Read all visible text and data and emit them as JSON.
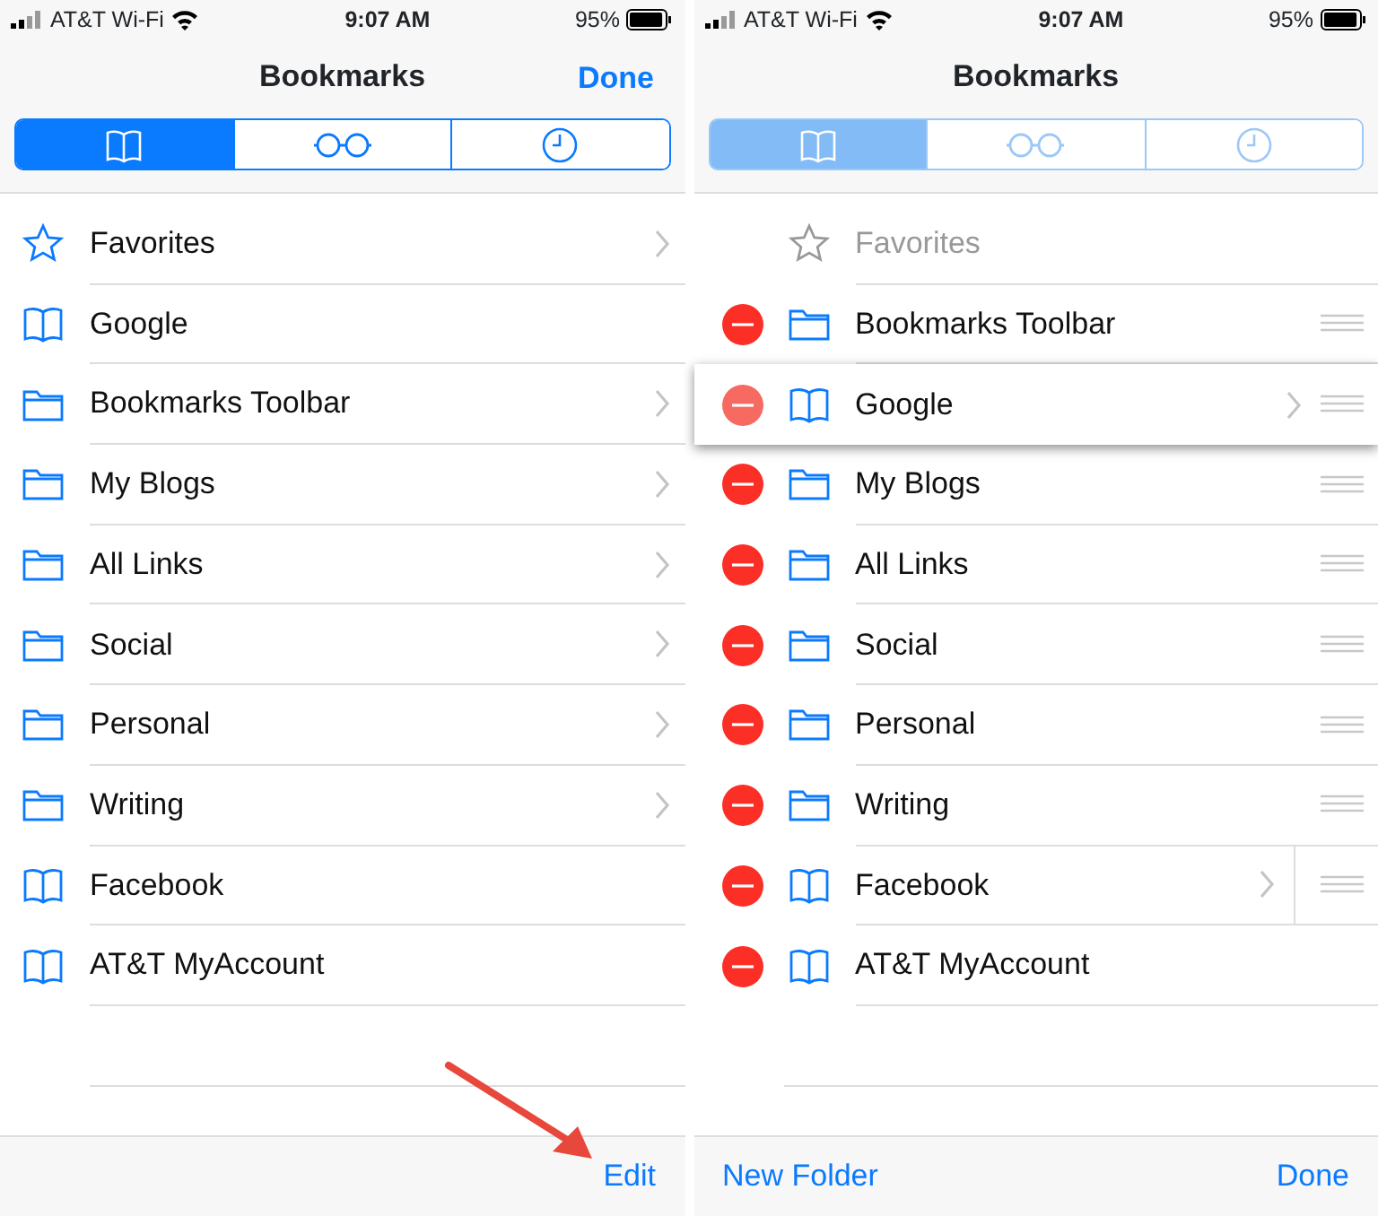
{
  "screens": [
    {
      "status": {
        "carrier": "AT&T Wi-Fi",
        "time": "9:07 AM",
        "battery": "95%"
      },
      "title": "Bookmarks",
      "nav_button": "Done",
      "editing": false,
      "segments": [
        {
          "kind": "bookmarks",
          "selected": true
        },
        {
          "kind": "reading-list",
          "selected": false
        },
        {
          "kind": "history",
          "selected": false
        }
      ],
      "items": [
        {
          "kind": "star",
          "label": "Favorites",
          "chevron": true
        },
        {
          "kind": "book",
          "label": "Google",
          "chevron": false
        },
        {
          "kind": "folder",
          "label": "Bookmarks Toolbar",
          "chevron": true
        },
        {
          "kind": "folder",
          "label": "My Blogs",
          "chevron": true
        },
        {
          "kind": "folder",
          "label": "All Links",
          "chevron": true
        },
        {
          "kind": "folder",
          "label": "Social",
          "chevron": true
        },
        {
          "kind": "folder",
          "label": "Personal",
          "chevron": true
        },
        {
          "kind": "folder",
          "label": "Writing",
          "chevron": true
        },
        {
          "kind": "book",
          "label": "Facebook",
          "chevron": false
        },
        {
          "kind": "book",
          "label": "AT&T MyAccount",
          "chevron": false
        }
      ],
      "toolbar": {
        "right": "Edit"
      },
      "annotation": {
        "kind": "arrow"
      }
    },
    {
      "status": {
        "carrier": "AT&T Wi-Fi",
        "time": "9:07 AM",
        "battery": "95%"
      },
      "title": "Bookmarks",
      "editing": true,
      "segments": [
        {
          "kind": "bookmarks",
          "selected": true
        },
        {
          "kind": "reading-list",
          "selected": false
        },
        {
          "kind": "history",
          "selected": false
        }
      ],
      "items": [
        {
          "kind": "star",
          "label": "Favorites",
          "chevron": false,
          "disabled": true,
          "deletable": false,
          "reorderable": false
        },
        {
          "kind": "folder",
          "label": "Bookmarks Toolbar",
          "chevron": false,
          "deletable": true,
          "reorderable": true
        },
        {
          "kind": "book",
          "label": "Google",
          "chevron": true,
          "dragging": true,
          "deletable": true,
          "reorderable": true
        },
        {
          "kind": "folder",
          "label": "My Blogs",
          "chevron": false,
          "deletable": true,
          "reorderable": true
        },
        {
          "kind": "folder",
          "label": "All Links",
          "chevron": false,
          "deletable": true,
          "reorderable": true
        },
        {
          "kind": "folder",
          "label": "Social",
          "chevron": false,
          "deletable": true,
          "reorderable": true
        },
        {
          "kind": "folder",
          "label": "Personal",
          "chevron": false,
          "deletable": true,
          "reorderable": true
        },
        {
          "kind": "folder",
          "label": "Writing",
          "chevron": false,
          "deletable": true,
          "reorderable": true
        },
        {
          "kind": "book",
          "label": "Facebook",
          "chevron": true,
          "deletable": true,
          "reorderable": true
        },
        {
          "kind": "book",
          "label": "AT&T MyAccount",
          "chevron": false,
          "deletable": true,
          "reorderable": false
        }
      ],
      "toolbar": {
        "left": "New Folder",
        "right": "Done"
      }
    }
  ]
}
